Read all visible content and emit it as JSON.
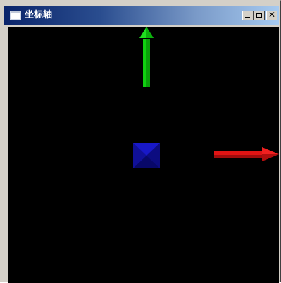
{
  "window": {
    "title": "坐标轴",
    "controls": {
      "minimize": "minimize",
      "maximize": "maximize",
      "close": "✕"
    }
  },
  "scene": {
    "background": "#000000",
    "axes": [
      {
        "name": "x-axis",
        "color": "#e01414",
        "direction": "right"
      },
      {
        "name": "y-axis",
        "color": "#10d010",
        "direction": "up"
      },
      {
        "name": "z-axis",
        "color": "#1414b8",
        "direction": "toward-viewer"
      }
    ]
  },
  "colors": {
    "title_bar_start": "#0a246a",
    "title_bar_end": "#a6caf0",
    "window_chrome": "#d4d0c8"
  }
}
